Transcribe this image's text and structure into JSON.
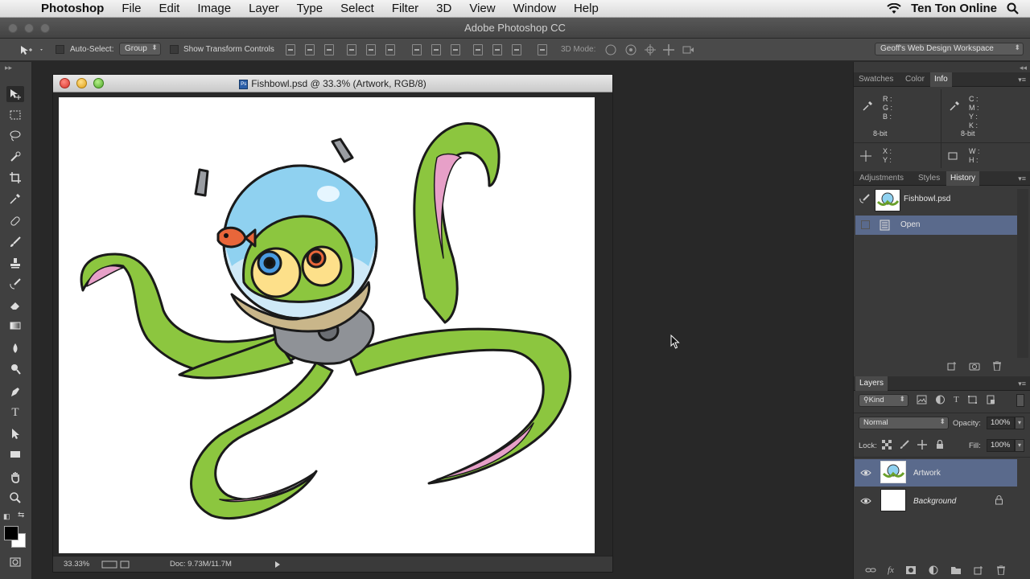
{
  "menubar": {
    "app": "Photoshop",
    "items": [
      "File",
      "Edit",
      "Image",
      "Layer",
      "Type",
      "Select",
      "Filter",
      "3D",
      "View",
      "Window",
      "Help"
    ],
    "user": "Ten Ton Online"
  },
  "window": {
    "title": "Adobe Photoshop CC"
  },
  "options": {
    "auto_select_label": "Auto-Select:",
    "auto_select_value": "Group",
    "show_transform_label": "Show Transform Controls",
    "mode_3d_label": "3D Mode:",
    "workspace": "Geoff's Web Design Workspace"
  },
  "document": {
    "title": "Fishbowl.psd @ 33.3% (Artwork, RGB/8)",
    "zoom": "33.33%",
    "doc_size": "Doc: 9.73M/11.7M"
  },
  "info_panel": {
    "tabs": [
      "Swatches",
      "Color",
      "Info"
    ],
    "active_tab": "Info",
    "rgb_labels": [
      "R :",
      "G :",
      "B :"
    ],
    "cmyk_labels": [
      "C :",
      "M :",
      "Y :",
      "K :"
    ],
    "bit_left": "8-bit",
    "bit_right": "8-bit",
    "xy_labels": [
      "X :",
      "Y :"
    ],
    "wh_labels": [
      "W :",
      "H :"
    ]
  },
  "history_panel": {
    "tabs": [
      "Adjustments",
      "Styles",
      "History"
    ],
    "active_tab": "History",
    "snapshot": "Fishbowl.psd",
    "states": [
      "Open"
    ]
  },
  "layers_panel": {
    "title": "Layers",
    "kind_filter": "Kind",
    "blend_mode": "Normal",
    "opacity_label": "Opacity:",
    "opacity": "100%",
    "lock_label": "Lock:",
    "fill_label": "Fill:",
    "fill": "100%",
    "layers": [
      {
        "name": "Artwork",
        "selected": true
      },
      {
        "name": "Background",
        "selected": false,
        "locked": true
      }
    ]
  }
}
